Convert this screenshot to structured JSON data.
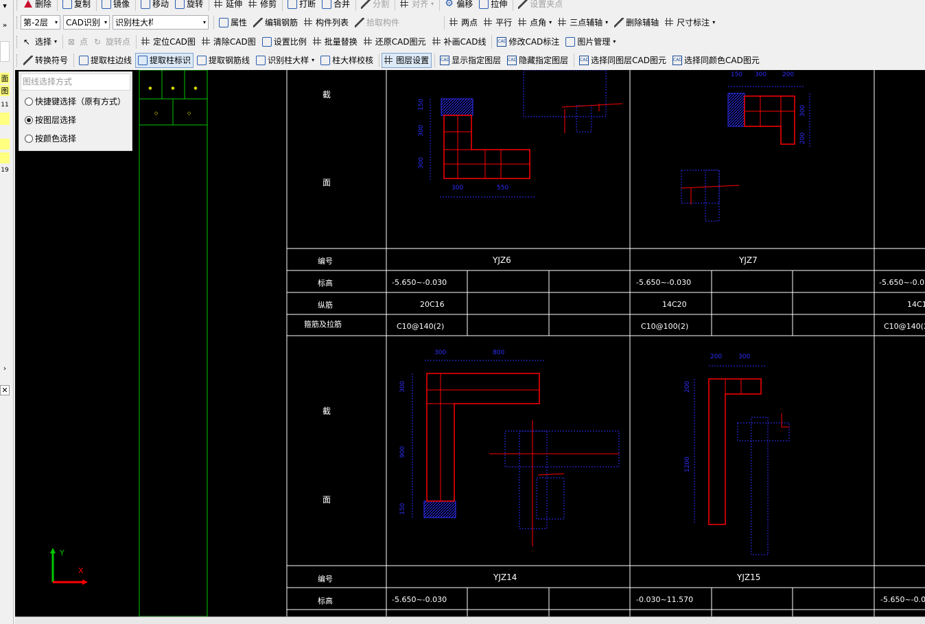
{
  "toolbar_row1": {
    "delete": "删除",
    "copy": "复制",
    "mirror": "镜像",
    "move": "移动",
    "rotate": "旋转",
    "extend": "延伸",
    "trim": "修剪",
    "break": "打断",
    "merge": "合并",
    "split": "分割",
    "align": "对齐",
    "offset": "偏移",
    "stretch": "拉伸",
    "set_grip": "设置夹点"
  },
  "toolbar_row2": {
    "floor": "第-2层",
    "cad_recognize": "CAD识别",
    "recognize_column": "识别柱大样",
    "properties": "属性",
    "edit_rebar": "编辑钢筋",
    "component_list": "构件列表",
    "pick_component": "拾取构件",
    "two_points": "两点",
    "parallel": "平行",
    "point_angle": "点角",
    "three_point_axis": "三点辅轴",
    "delete_axis": "删除辅轴",
    "dimension": "尺寸标注"
  },
  "toolbar_row3": {
    "select": "选择",
    "point": "点",
    "rotate_point": "旋转点",
    "locate_cad": "定位CAD图",
    "clear_cad": "清除CAD图",
    "set_scale": "设置比例",
    "batch_replace": "批量替换",
    "restore_cad": "还原CAD图元",
    "patch_cad": "补画CAD线",
    "modify_cad_label": "修改CAD标注",
    "image_manage": "图片管理"
  },
  "toolbar_row4": {
    "convert_symbol": "转换符号",
    "extract_col_edge": "提取柱边线",
    "extract_col_label": "提取柱标识",
    "extract_rebar_line": "提取钢筋线",
    "recognize_col_detail": "识别柱大样",
    "col_detail_check": "柱大样校核",
    "layer_settings": "图层设置",
    "show_layer": "显示指定图层",
    "hide_layer": "隐藏指定图层",
    "select_same_layer": "选择同图层CAD图元",
    "select_same_color": "选择同颜色CAD图元"
  },
  "left_strip": {
    "c1": "面",
    "c2": "图",
    "c3": "11",
    "c4": "19"
  },
  "panel": {
    "title": "图线选择方式",
    "options": [
      "快捷键选择（原有方式）",
      "按图层选择",
      "按颜色选择"
    ],
    "selected": 1
  },
  "drawing": {
    "row_labels": {
      "section_top": "截",
      "section_bottom": "面",
      "number": "编号",
      "elevation": "标高",
      "longitudinal": "纵筋",
      "stirrup": "箍筋及拉筋"
    },
    "block1": {
      "name1": "YJZ6",
      "name2": "YJZ7",
      "elev1": "-5.650~-0.030",
      "elev2": "-5.650~-0.030",
      "elev3": "-5.650~-0.0",
      "bar1": "20C16",
      "bar2": "14C20",
      "bar3": "14C1",
      "stir1": "C10@140(2)",
      "stir2": "C10@100(2)",
      "stir3": "C10@140(2"
    },
    "block2": {
      "name1": "YJZ14",
      "name2": "YJZ15",
      "elev1": "-5.650~-0.030",
      "elev2": "-0.030~11.570",
      "elev3": "-5.650~-0.0"
    },
    "dims": {
      "d300": "300",
      "d550": "550",
      "d150": "150",
      "d200": "200",
      "d800": "800",
      "d900": "900",
      "d1200": "1200"
    },
    "axis": {
      "x": "X",
      "y": "Y"
    }
  },
  "colors": {
    "cad_bg": "#000000",
    "cad_white": "#ffffff",
    "cad_red": "#ff0000",
    "cad_blue": "#2f2fff",
    "cad_green": "#00c800",
    "cad_yellow": "#ffff00"
  }
}
